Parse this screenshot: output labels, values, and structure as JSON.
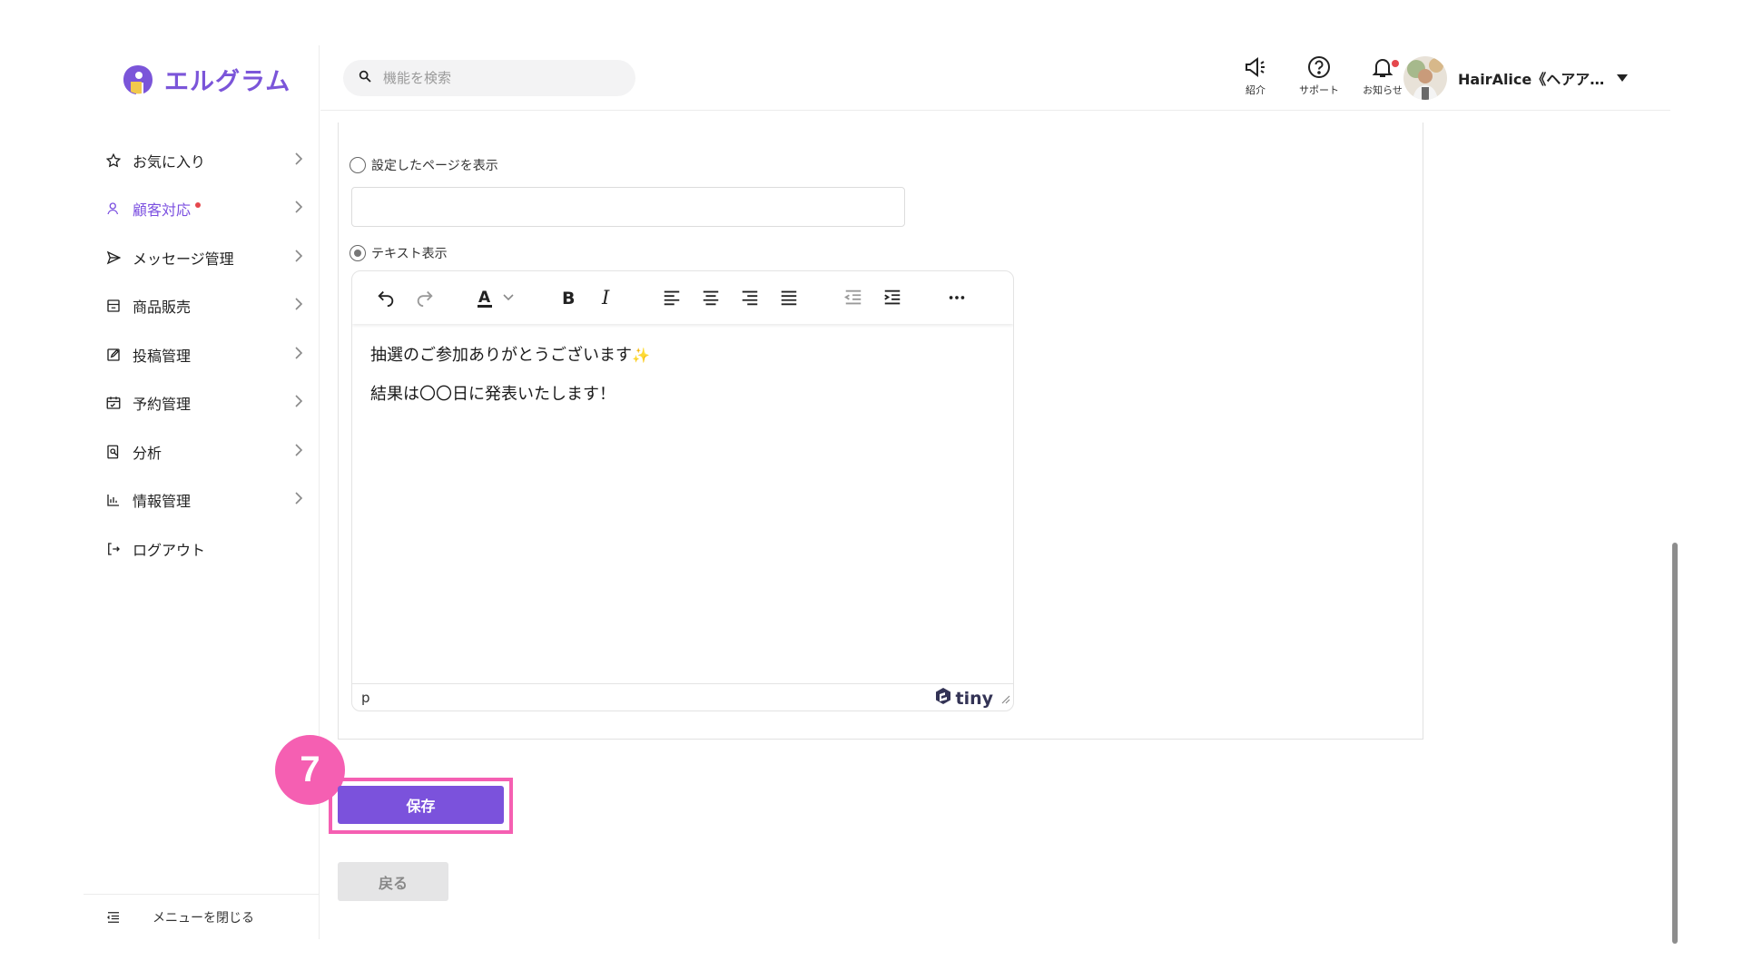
{
  "app": {
    "name": "エルグラム",
    "brand_color": "#7b55d9"
  },
  "sidebar": {
    "items": [
      {
        "label": "お気に入り",
        "icon": "star-icon"
      },
      {
        "label": "顧客対応",
        "icon": "person-icon",
        "active": true,
        "has_notification": true
      },
      {
        "label": "メッセージ管理",
        "icon": "send-icon"
      },
      {
        "label": "商品販売",
        "icon": "shop-icon"
      },
      {
        "label": "投稿管理",
        "icon": "edit-icon"
      },
      {
        "label": "予約管理",
        "icon": "calendar-icon"
      },
      {
        "label": "分析",
        "icon": "analysis-icon"
      },
      {
        "label": "情報管理",
        "icon": "chart-icon"
      },
      {
        "label": "ログアウト",
        "icon": "logout-icon"
      }
    ],
    "footer_label": "メニューを閉じる"
  },
  "header": {
    "search_placeholder": "機能を検索",
    "icons": [
      {
        "label": "紹介",
        "icon": "megaphone-icon"
      },
      {
        "label": "サポート",
        "icon": "help-icon"
      },
      {
        "label": "お知らせ",
        "icon": "bell-icon",
        "has_notification": true
      }
    ],
    "user_name": "HairAlice《ヘアア…"
  },
  "form": {
    "option_page_label": "設定したページを表示",
    "option_text_label": "テキスト表示",
    "selected_option": "text",
    "editor": {
      "lines": [
        "抽選のご参加ありがとうございます",
        "結果は〇〇日に発表いたします！"
      ],
      "sparkle": "✨",
      "status_path": "p",
      "brand": "tiny"
    },
    "save_label": "保存",
    "back_label": "戻る"
  },
  "annotation": {
    "step_number": "7",
    "color": "#f55fb2"
  }
}
